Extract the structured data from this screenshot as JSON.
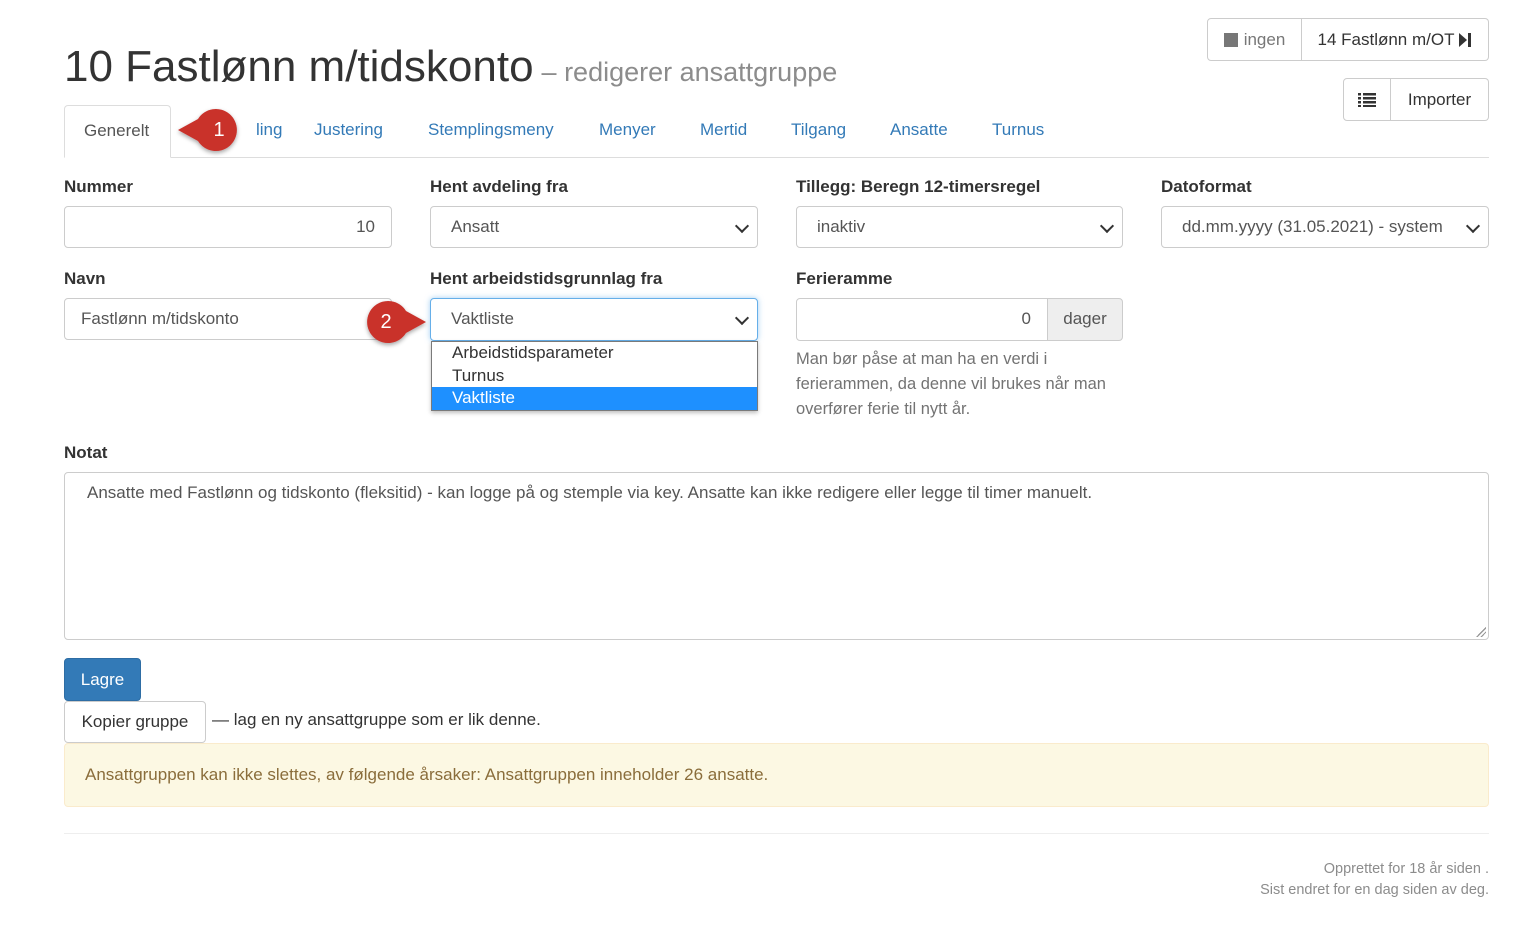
{
  "header": {
    "title": "10 Fastlønn m/tidskonto",
    "subtitle": "– redigerer ansattgruppe"
  },
  "nav": {
    "prev_label": "ingen",
    "next_label": "14 Fastlønn m/OT",
    "import_label": "Importer"
  },
  "tabs": [
    "Generelt",
    "Avregning",
    "Justering",
    "Stemplingsmeny",
    "Menyer",
    "Mertid",
    "Tilgang",
    "Ansatte",
    "Turnus"
  ],
  "tab_visible": {
    "avregning_visible": "ling"
  },
  "form": {
    "nummer_label": "Nummer",
    "nummer_value": "10",
    "avdeling_label": "Hent avdeling fra",
    "avdeling_value": "Ansatt",
    "tillegg_label": "Tillegg: Beregn 12-timersregel",
    "tillegg_value": "inaktiv",
    "datoformat_label": "Datoformat",
    "datoformat_value": "dd.mm.yyyy (31.05.2021) - system",
    "navn_label": "Navn",
    "navn_value": "Fastlønn m/tidskonto",
    "arbeidstid_label": "Hent arbeidstidsgrunnlag fra",
    "arbeidstid_value": "Vaktliste",
    "arbeidstid_options": [
      "Arbeidstidsparameter",
      "Turnus",
      "Vaktliste"
    ],
    "ferieramme_label": "Ferieramme",
    "ferieramme_value": "0",
    "ferieramme_unit": "dager",
    "ferieramme_help": "Man bør påse at man ha en verdi i ferierammen, da denne vil brukes når man overfører ferie til nytt år.",
    "notat_label": "Notat",
    "notat_value": "Ansatte med Fastlønn og tidskonto (fleksitid) - kan logge på og stemple via key. Ansatte kan ikke redigere eller legge til timer manuelt."
  },
  "actions": {
    "save_label": "Lagre",
    "copy_label": "Kopier gruppe",
    "copy_note": "— lag en ny ansattgruppe som er lik denne."
  },
  "alert": {
    "text": "Ansattgruppen kan ikke slettes, av følgende årsaker: Ansattgruppen inneholder 26 ansatte."
  },
  "footer": {
    "created": "Opprettet for 18 år siden .",
    "changed": "Sist endret for en dag siden av deg."
  },
  "callouts": [
    "1",
    "2"
  ],
  "colors": {
    "primary": "#337ab7",
    "link": "#337ab7",
    "callout": "#c9302c",
    "alert_bg": "#fcf8e3",
    "alert_text": "#8a6d3b",
    "option_selected": "#1e90ff"
  }
}
